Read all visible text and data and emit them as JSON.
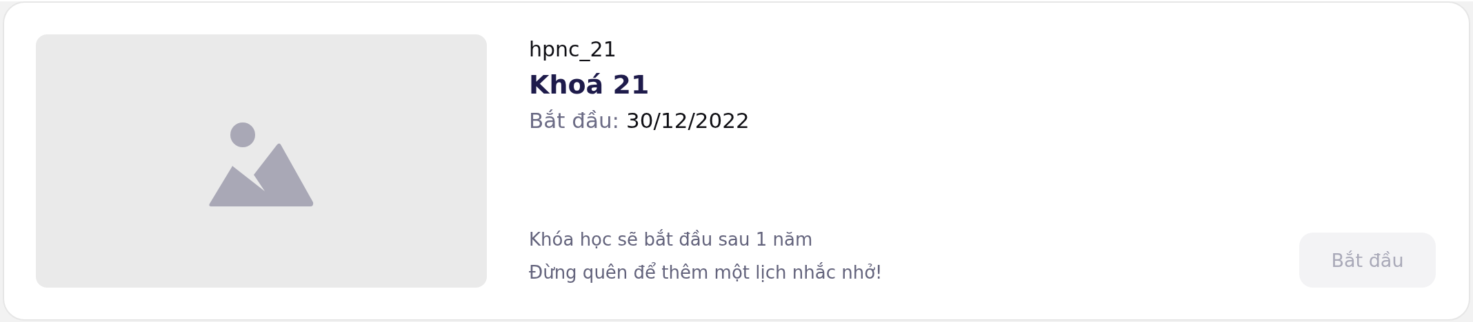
{
  "course": {
    "code": "hpnc_21",
    "title": "Khoá 21",
    "start_label": "Bắt đầu:",
    "start_date": "30/12/2022",
    "notice_lines": [
      "Khóa học sẽ bắt đầu sau 1 năm",
      "Đừng quên để thêm một lịch nhắc nhở!"
    ],
    "button": {
      "label": "Bắt đầu",
      "disabled": true
    }
  }
}
